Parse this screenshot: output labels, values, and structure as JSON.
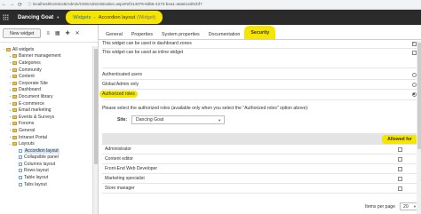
{
  "browser": {
    "back_glyph": "←",
    "forward_glyph": "→",
    "reload_glyph": "⟳",
    "url_scheme": "ⓘ ",
    "url": "localhost/Kentico8/Admin/CMSAdministration.aspx#ef314079-8db6-4273-bea1-a6a614d0cbf7"
  },
  "app_bar": {
    "site_name": "Dancing Goat",
    "site_caret": "▼",
    "breadcrumb": {
      "root": "Widgets",
      "separator": ">",
      "current": "Accordion layout",
      "current_type": "(Widget)"
    },
    "highlight_color": "#f5e500"
  },
  "left_toolbar": {
    "new_button": "New widget",
    "icons": [
      "≡",
      "▦",
      "✚",
      "✕"
    ]
  },
  "tree": [
    {
      "label": "All widgets",
      "level": 0,
      "toggle": "−",
      "icon": "folder"
    },
    {
      "label": "Banner management",
      "level": 1,
      "toggle": "+",
      "icon": "folder"
    },
    {
      "label": "Categories",
      "level": 1,
      "toggle": "+",
      "icon": "folder"
    },
    {
      "label": "Community",
      "level": 1,
      "toggle": "+",
      "icon": "folder"
    },
    {
      "label": "Content",
      "level": 1,
      "toggle": "+",
      "icon": "folder"
    },
    {
      "label": "Corporate Site",
      "level": 1,
      "toggle": "+",
      "icon": "folder"
    },
    {
      "label": "Dashboard",
      "level": 1,
      "toggle": "+",
      "icon": "folder"
    },
    {
      "label": "Document library",
      "level": 1,
      "toggle": "+",
      "icon": "folder"
    },
    {
      "label": "E-commerce",
      "level": 1,
      "toggle": "+",
      "icon": "folder"
    },
    {
      "label": "Email marketing",
      "level": 1,
      "toggle": "+",
      "icon": "folder"
    },
    {
      "label": "Events & Surveys",
      "level": 1,
      "toggle": "+",
      "icon": "folder"
    },
    {
      "label": "Forums",
      "level": 1,
      "toggle": "+",
      "icon": "folder"
    },
    {
      "label": "General",
      "level": 1,
      "toggle": "+",
      "icon": "folder"
    },
    {
      "label": "Intranet Portal",
      "level": 1,
      "toggle": "+",
      "icon": "folder"
    },
    {
      "label": "Layouts",
      "level": 1,
      "toggle": "−",
      "icon": "folder"
    },
    {
      "label": "Accordion layout",
      "level": 2,
      "toggle": "",
      "icon": "widget",
      "selected": true
    },
    {
      "label": "Collapsible panel",
      "level": 2,
      "toggle": "",
      "icon": "widget"
    },
    {
      "label": "Columns layout",
      "level": 2,
      "toggle": "",
      "icon": "widget"
    },
    {
      "label": "Rows layout",
      "level": 2,
      "toggle": "",
      "icon": "widget"
    },
    {
      "label": "Table layout",
      "level": 2,
      "toggle": "",
      "icon": "widget"
    },
    {
      "label": "Tabs layout",
      "level": 2,
      "toggle": "",
      "icon": "widget"
    }
  ],
  "tabs": [
    {
      "label": "General",
      "active": false
    },
    {
      "label": "Properties",
      "active": false
    },
    {
      "label": "System properties",
      "active": false
    },
    {
      "label": "Documentation",
      "active": false
    },
    {
      "label": "Security",
      "active": true
    }
  ],
  "security": {
    "options": [
      {
        "label": "This widget can be used in dashboard zones",
        "checked": true
      },
      {
        "label": "This widget can be used as inline widget",
        "checked": false
      }
    ],
    "access": [
      {
        "label": "Authenticated users",
        "selected": false,
        "highlight": false
      },
      {
        "label": "Global Admin only",
        "selected": false,
        "highlight": false
      },
      {
        "label": "Authorized roles",
        "selected": true,
        "highlight": true
      }
    ],
    "note": "Please select the authorized roles (available only when you select the \"Authorized roles\" option above):",
    "site_label": "Site:",
    "site_value": "Dancing Goat",
    "site_caret": "▼",
    "grid_header": "Allowed for",
    "roles": [
      {
        "label": "Administrator",
        "allowed": false
      },
      {
        "label": "Content editor",
        "allowed": false
      },
      {
        "label": "Front-End Web Developer",
        "allowed": false
      },
      {
        "label": "Marketing specialist",
        "allowed": false
      },
      {
        "label": "Store manager",
        "allowed": false
      }
    ],
    "pager_label": "Items per page",
    "pager_value": "20",
    "pager_caret": "▼",
    "check_glyph": "✓"
  }
}
